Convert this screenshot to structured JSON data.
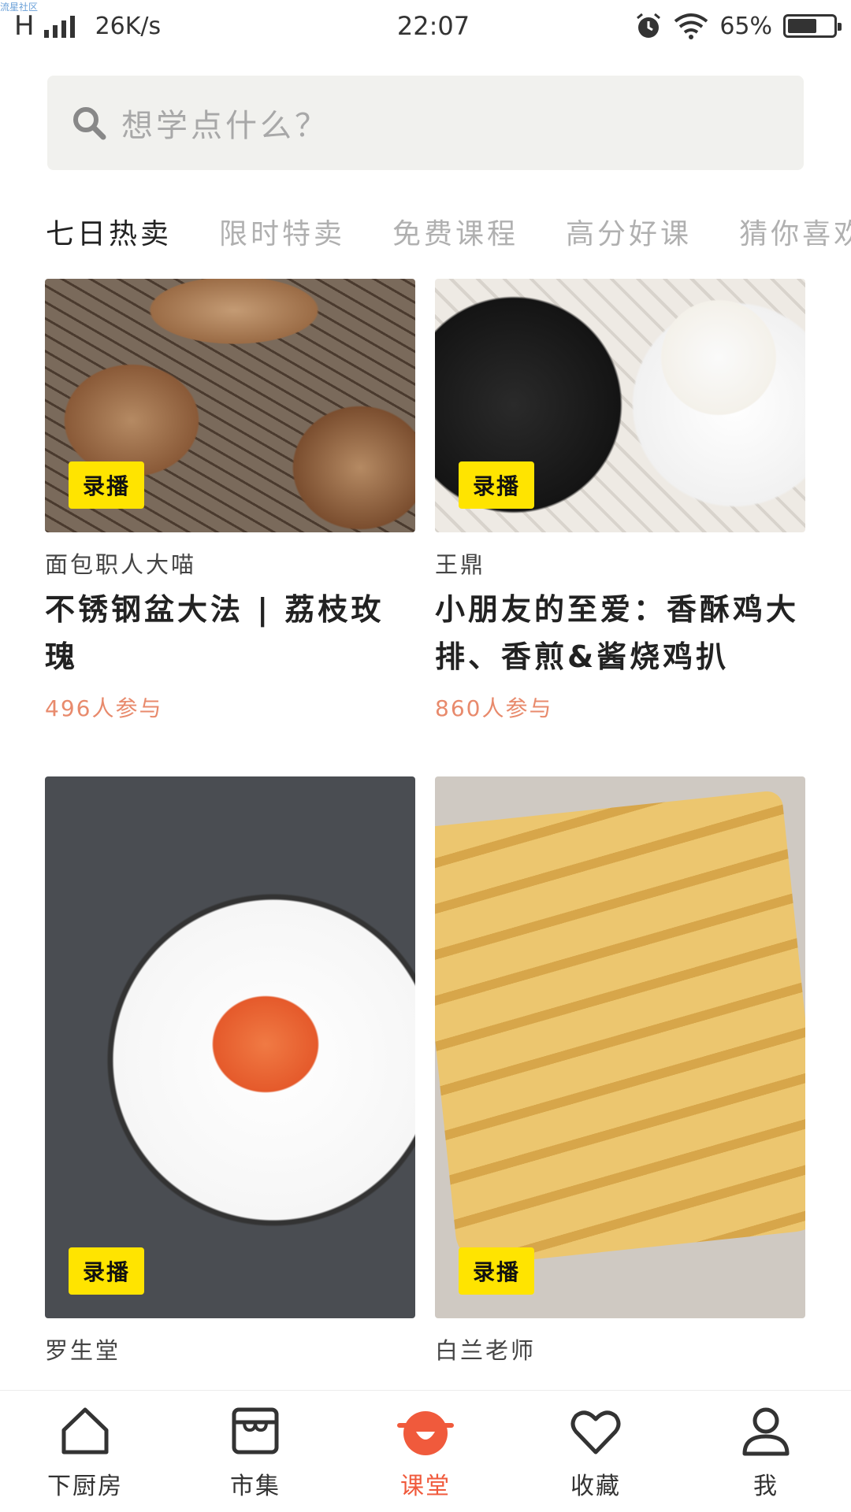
{
  "watermark": "流星社区",
  "status_bar": {
    "carrier_letter": "H",
    "speed": "26K/s",
    "time": "22:07",
    "battery": "65%",
    "battery_level": 0.65
  },
  "search": {
    "placeholder": "想学点什么？"
  },
  "tabs": [
    {
      "label": "七日热卖",
      "active": true
    },
    {
      "label": "限时特卖",
      "active": false
    },
    {
      "label": "免费课程",
      "active": false
    },
    {
      "label": "高分好课",
      "active": false
    },
    {
      "label": "猜你喜欢",
      "active": false
    }
  ],
  "cards": [
    {
      "badge": "录播",
      "author": "面包职人大喵",
      "title": "不锈钢盆大法 | 荔枝玫瑰",
      "count": "496人参与"
    },
    {
      "badge": "录播",
      "author": "王鼎",
      "title": "小朋友的至爱：香酥鸡大排、香煎&酱烧鸡扒",
      "count": "860人参与"
    },
    {
      "badge": "录播",
      "author": "罗生堂",
      "title": "",
      "count": ""
    },
    {
      "badge": "录播",
      "author": "白兰老师",
      "title": "",
      "count": ""
    }
  ],
  "bottom_nav": [
    {
      "label": "下厨房",
      "icon": "house-icon",
      "active": false
    },
    {
      "label": "市集",
      "icon": "store-icon",
      "active": false
    },
    {
      "label": "课堂",
      "icon": "pot-icon",
      "active": true
    },
    {
      "label": "收藏",
      "icon": "heart-icon",
      "active": false
    },
    {
      "label": "我",
      "icon": "person-icon",
      "active": false
    }
  ],
  "colors": {
    "accent": "#f05a3c",
    "badge": "#ffe400",
    "count": "#e88a6c"
  }
}
